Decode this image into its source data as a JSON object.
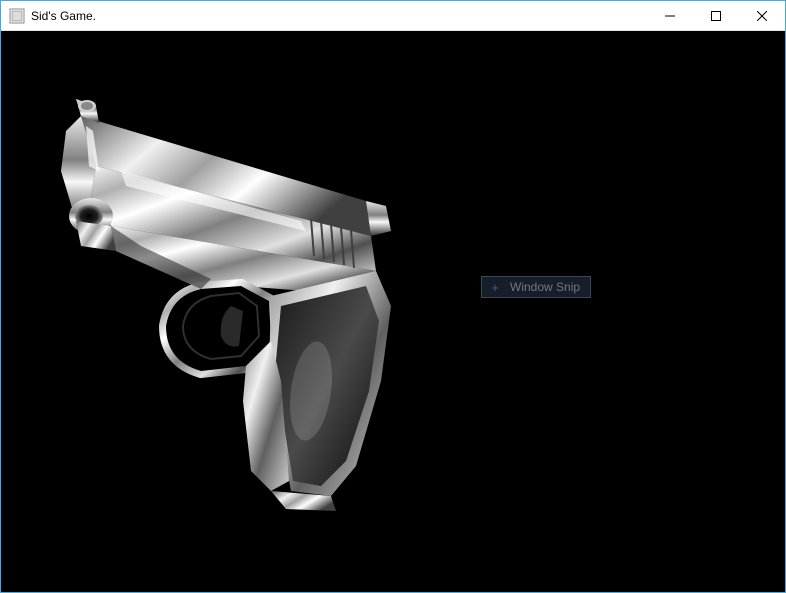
{
  "window": {
    "title": "Sid's Game.",
    "icon_name": "app-icon"
  },
  "controls": {
    "minimize_label": "Minimize",
    "maximize_label": "Maximize",
    "close_label": "Close"
  },
  "scene": {
    "object_name": "handgun-model",
    "background_color": "#000000"
  },
  "tooltip": {
    "icon": "+",
    "label": "Window Snip"
  }
}
